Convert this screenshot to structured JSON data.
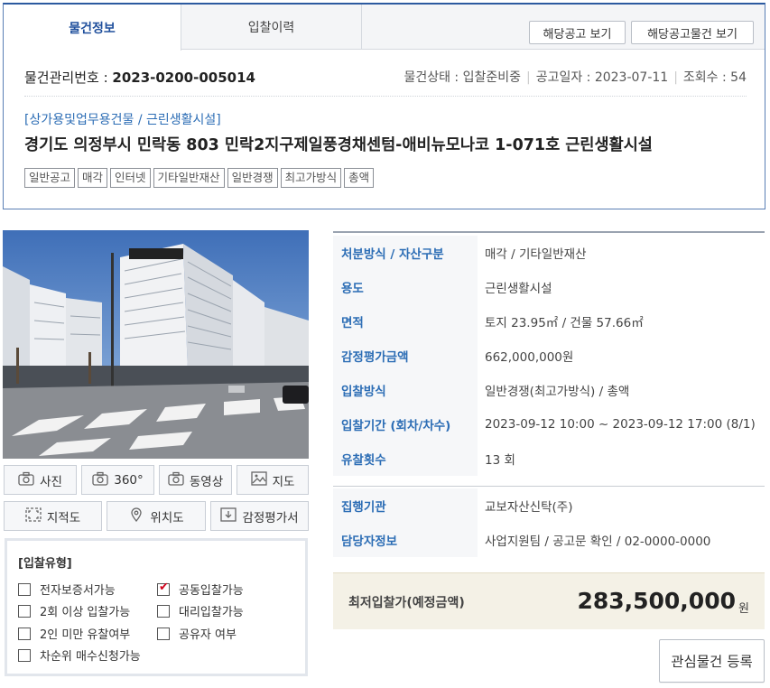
{
  "tabs": [
    {
      "label": "물건정보"
    },
    {
      "label": "입찰이력"
    }
  ],
  "header_buttons": {
    "notice": "해당공고 보기",
    "notice_items": "해당공고물건 보기"
  },
  "meta": {
    "mgmt_label": "물건관리번호 : ",
    "mgmt_no": "2023-0200-005014",
    "status": "물건상태 : 입찰준비중",
    "notice_date": "공고일자 : 2023-07-11",
    "views": "조회수 : 54"
  },
  "category": "[상가용및업무용건물 / 근린생활시설]",
  "title": "경기도 의정부시 민락동 803 민락2지구제일풍경채센텀-애비뉴모나코 1-071호 근린생활시설",
  "tags": [
    "일반공고",
    "매각",
    "인터넷",
    "기타일반재산",
    "일반경쟁",
    "최고가방식",
    "총액"
  ],
  "media_buttons": [
    {
      "label": "사진",
      "icon": "camera-icon"
    },
    {
      "label": "360°",
      "icon": "camera-icon"
    },
    {
      "label": "동영상",
      "icon": "camera-icon"
    },
    {
      "label": "지도",
      "icon": "image-icon"
    },
    {
      "label": "지적도",
      "icon": "expand-icon"
    },
    {
      "label": "위치도",
      "icon": "location-pin-icon"
    },
    {
      "label": "감정평가서",
      "icon": "download-icon"
    }
  ],
  "bid_type": {
    "title": "[입찰유형]",
    "options": [
      {
        "label": "전자보증서가능",
        "checked": false
      },
      {
        "label": "공동입찰가능",
        "checked": true
      },
      {
        "label": "2회 이상 입찰가능",
        "checked": false
      },
      {
        "label": "대리입찰가능",
        "checked": false
      },
      {
        "label": "2인 미만 유찰여부",
        "checked": false
      },
      {
        "label": "공유자 여부",
        "checked": false
      },
      {
        "label": "차순위 매수신청가능",
        "checked": false
      }
    ]
  },
  "info": [
    {
      "label": "처분방식 / 자산구분",
      "value": "매각 / 기타일반재산"
    },
    {
      "label": "용도",
      "value": "근린생활시설"
    },
    {
      "label": "면적",
      "value": "토지 23.95㎡ / 건물 57.66㎡"
    },
    {
      "label": "감정평가금액",
      "value": "662,000,000원"
    },
    {
      "label": "입찰방식",
      "value": "일반경쟁(최고가방식) / 총액"
    },
    {
      "label": "입찰기간 (회차/차수)",
      "value": "2023-09-12 10:00 ~ 2023-09-12 17:00 (8/1)"
    },
    {
      "label": "유찰횟수",
      "value": "13 회"
    },
    {
      "label": "집행기관",
      "value": "교보자산신탁(주)"
    },
    {
      "label": "담당자정보",
      "value": "사업지원팀 / 공고문 확인 / 02-0000-0000"
    }
  ],
  "price": {
    "label": "최저입찰가(예정금액)",
    "value": "283,500,000",
    "unit": "원"
  },
  "watch_button": "관심물건 등록",
  "colors": {
    "accent": "#2c6db5",
    "check": "#d0021b",
    "price_bg": "#f4f1e6"
  }
}
